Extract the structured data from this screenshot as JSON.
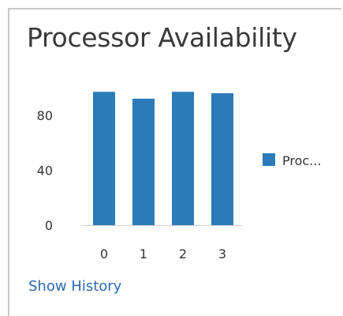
{
  "tile": {
    "title": "Processor Availability",
    "link_label": "Show History"
  },
  "chart_data": {
    "type": "bar",
    "categories": [
      "0",
      "1",
      "2",
      "3"
    ],
    "series": [
      {
        "name": "Proc...",
        "values": [
          97,
          92,
          97,
          96
        ]
      }
    ],
    "y_ticks": [
      "0",
      "40",
      "80"
    ],
    "ylim": [
      0,
      100
    ],
    "grid": false,
    "legend": "right",
    "bar_color": "#2b7bb9"
  },
  "colors": {
    "bar": "#2b7bb9",
    "axis": "#d0d0d0",
    "link": "#2a6ab3",
    "title": "#3a3a3a"
  }
}
